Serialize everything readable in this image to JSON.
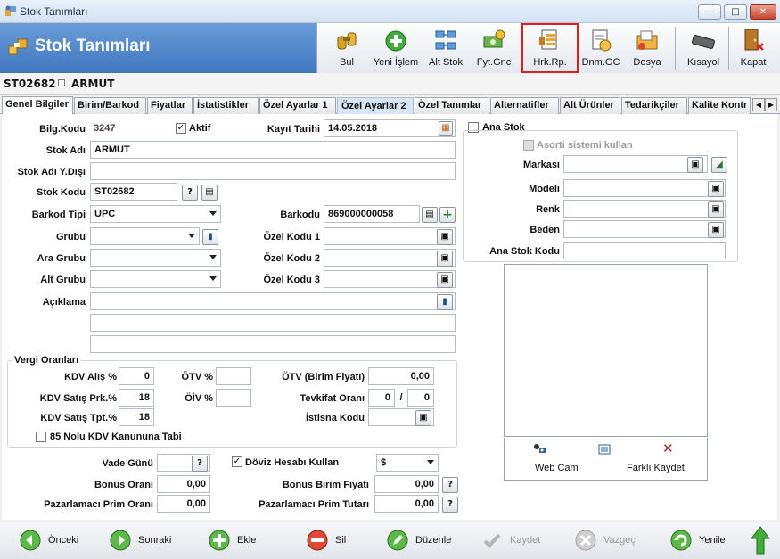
{
  "window": {
    "title": "Stok Tanımları"
  },
  "header": {
    "title": "Stok Tanımları"
  },
  "toolbar": [
    {
      "label": "Bul",
      "icon": "search-binoculars-icon"
    },
    {
      "label": "Yeni İşlem",
      "icon": "add-icon"
    },
    {
      "label": "Alt Stok",
      "icon": "network-icon"
    },
    {
      "label": "Fyt.Gnc",
      "icon": "price-update-icon"
    },
    {
      "label": "Hrk.Rp.",
      "icon": "movement-report-icon"
    },
    {
      "label": "Dnm.GC",
      "icon": "period-report-icon"
    },
    {
      "label": "Dosya",
      "icon": "file-folder-icon"
    },
    {
      "label": "Kısayol",
      "icon": "keyboard-icon"
    },
    {
      "label": "Kapat",
      "icon": "exit-door-icon"
    }
  ],
  "record": {
    "code": "ST02682",
    "name": "ARMUT"
  },
  "tabs": [
    "Genel Bilgiler",
    "Birim/Barkod",
    "Fiyatlar",
    "İstatistikler",
    "Özel Ayarlar 1",
    "Özel Ayarlar 2",
    "Özel Tanımlar",
    "Alternatifler",
    "Alt Ürünler",
    "Tedarikçiler",
    "Kalite Kontr"
  ],
  "form": {
    "bilg_kodu_label": "Bilg.Kodu",
    "bilg_kodu": "3247",
    "aktif_label": "Aktif",
    "kayit_tarihi_label": "Kayıt Tarihi",
    "kayit_tarihi": "14.05.2018",
    "stok_adi_label": "Stok Adı",
    "stok_adi": "ARMUT",
    "stok_adi_yd_label": "Stok Adı Y.Dışı",
    "stok_adi_yd": "",
    "stok_kodu_label": "Stok Kodu",
    "stok_kodu": "ST02682",
    "barkod_tipi_label": "Barkod Tipi",
    "barkod_tipi": "UPC",
    "barkodu_label": "Barkodu",
    "barkodu": "869000000058",
    "grubu_label": "Grubu",
    "ara_grubu_label": "Ara Grubu",
    "alt_grubu_label": "Alt Grubu",
    "ozel_kodu_1_label": "Özel Kodu 1",
    "ozel_kodu_2_label": "Özel Kodu 2",
    "ozel_kodu_3_label": "Özel Kodu 3",
    "aciklama_label": "Açıklama"
  },
  "right": {
    "ana_stok_label": "Ana Stok",
    "asorti_label": "Asorti sistemi kullan",
    "markasi_label": "Markası",
    "modeli_label": "Modeli",
    "renk_label": "Renk",
    "beden_label": "Beden",
    "ana_stok_kodu_label": "Ana Stok Kodu",
    "webcam_label": "Web Cam",
    "farkli_kaydet_label": "Farklı Kaydet"
  },
  "vergi": {
    "title": "Vergi Oranları",
    "kdv_alis_label": "KDV Alış %",
    "kdv_alis": "0",
    "kdv_satis_prk_label": "KDV Satış Prk.%",
    "kdv_satis_prk": "18",
    "kdv_satis_tpt_label": "KDV Satış Tpt.%",
    "kdv_satis_tpt": "18",
    "otv_label": "ÖTV %",
    "oiv_label": "ÖİV %",
    "otv_birim_label": "ÖTV (Birim Fiyatı)",
    "otv_birim": "0,00",
    "tevkifat_label": "Tevkifat Oranı",
    "tevkifat_1": "0",
    "tevkifat_sep": "/",
    "tevkifat_2": "0",
    "istisna_label": "İstisna Kodu",
    "kanun_label": "85 Nolu KDV Kanununa Tabi"
  },
  "bottomform": {
    "vade_label": "Vade Günü",
    "doviz_label": "Döviz Hesabı Kullan",
    "doviz_value": "$",
    "bonus_orani_label": "Bonus Oranı",
    "bonus_orani": "0,00",
    "bonus_birim_label": "Bonus Birim Fiyatı",
    "bonus_birim": "0,00",
    "pz_prim_orani_label": "Pazarlamacı Prim Oranı",
    "pz_prim_orani": "0,00",
    "pz_prim_tutari_label": "Pazarlamacı Prim Tutarı",
    "pz_prim_tutari": "0,00",
    "help": "?"
  },
  "bottombar": [
    {
      "label": "Önceki",
      "icon": "previous-icon",
      "enabled": true
    },
    {
      "label": "Sonraki",
      "icon": "next-icon",
      "enabled": true
    },
    {
      "label": "Ekle",
      "icon": "add-icon",
      "enabled": true
    },
    {
      "label": "Sil",
      "icon": "delete-icon",
      "enabled": true
    },
    {
      "label": "Düzenle",
      "icon": "edit-icon",
      "enabled": true
    },
    {
      "label": "Kaydet",
      "icon": "save-check-icon",
      "enabled": false
    },
    {
      "label": "Vazgeç",
      "icon": "cancel-icon",
      "enabled": false
    },
    {
      "label": "Yenile",
      "icon": "refresh-icon",
      "enabled": true
    }
  ],
  "colors": {
    "accent": "#3f77bf",
    "highlight_border": "#e02020"
  }
}
